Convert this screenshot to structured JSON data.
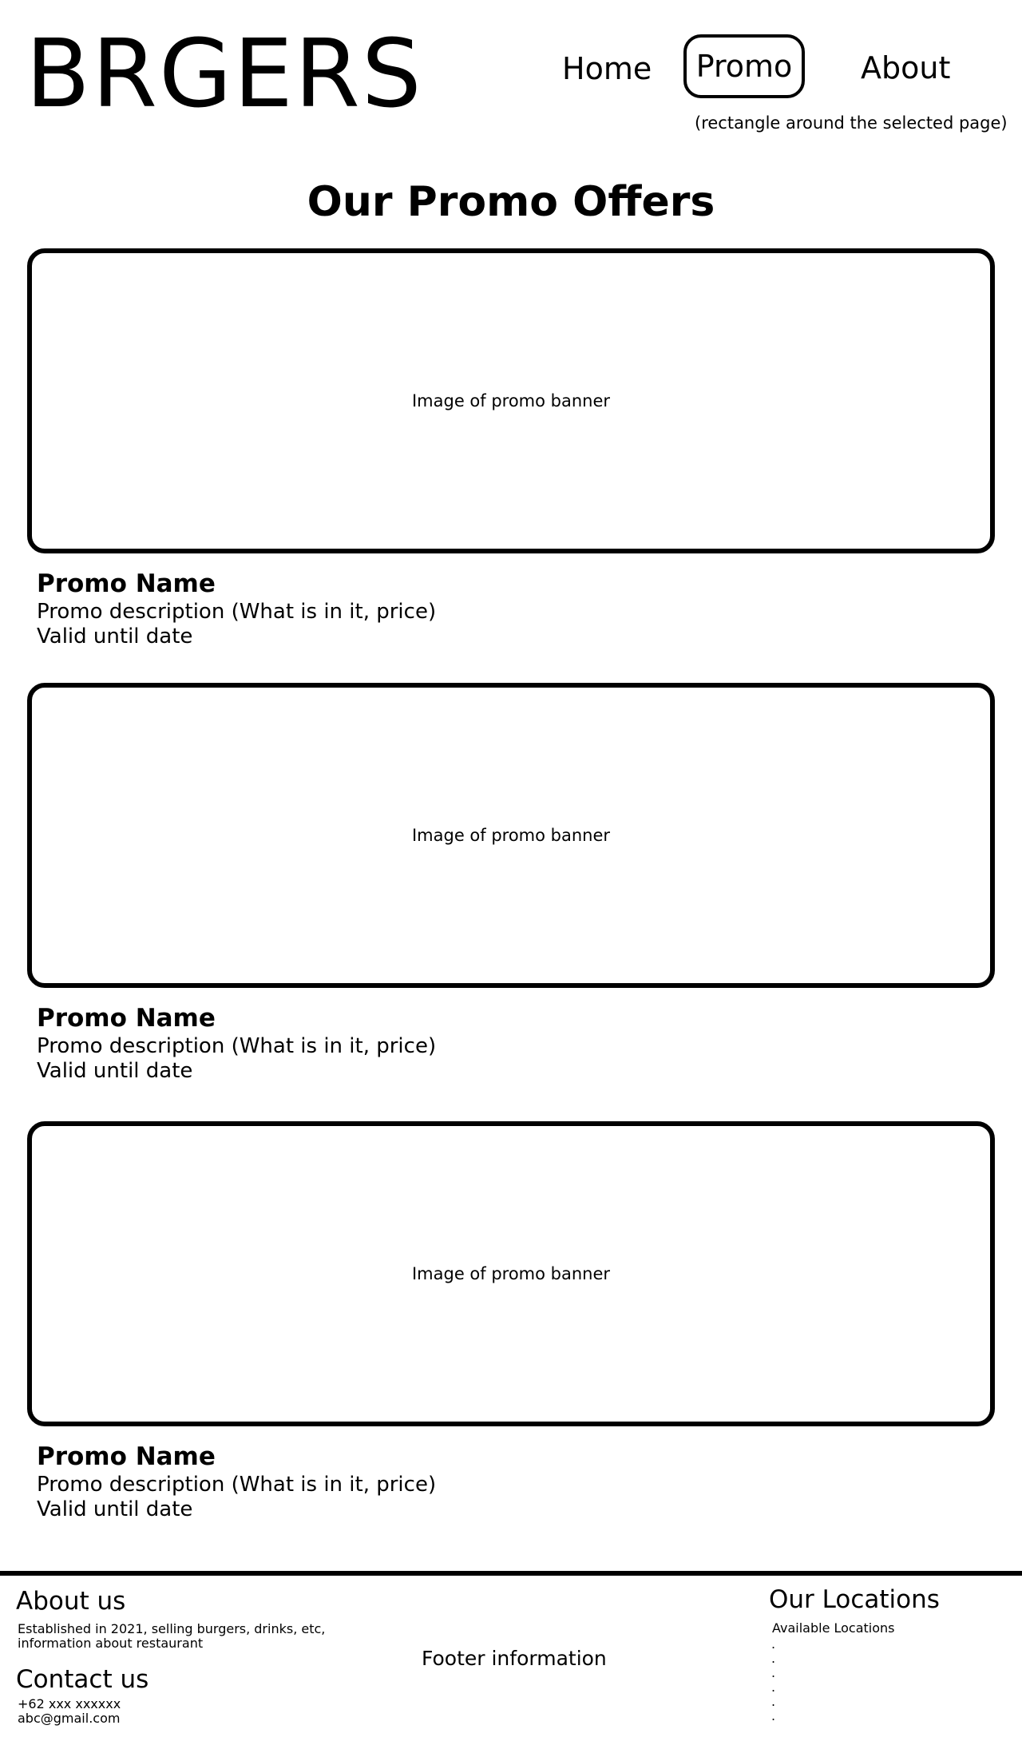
{
  "header": {
    "logo": "BRGERS",
    "nav": [
      {
        "label": "Home"
      },
      {
        "label": "Promo"
      },
      {
        "label": "About"
      }
    ],
    "nav_note": "(rectangle around the selected page)",
    "selected": "Promo"
  },
  "main": {
    "title": "Our Promo Offers",
    "promos": [
      {
        "banner": "Image of promo banner",
        "name": "Promo Name",
        "description": "Promo description (What is in it, price)",
        "valid": "Valid until date"
      },
      {
        "banner": "Image of promo banner",
        "name": "Promo Name",
        "description": "Promo description (What is in it, price)",
        "valid": "Valid until date"
      },
      {
        "banner": "Image of promo banner",
        "name": "Promo Name",
        "description": "Promo description (What is in it, price)",
        "valid": "Valid until date"
      }
    ]
  },
  "footer": {
    "about_heading": "About us",
    "about_line1": "Established in 2021, selling burgers, drinks, etc,",
    "about_line2": "information about restaurant",
    "contact_heading": "Contact us",
    "phone": "+62 xxx xxxxxx",
    "email": "abc@gmail.com",
    "center": "Footer information",
    "locations_heading": "Our Locations",
    "locations_sub": "Available Locations",
    "location_dots": [
      ".",
      ".",
      ".",
      ".",
      ".",
      "."
    ]
  }
}
